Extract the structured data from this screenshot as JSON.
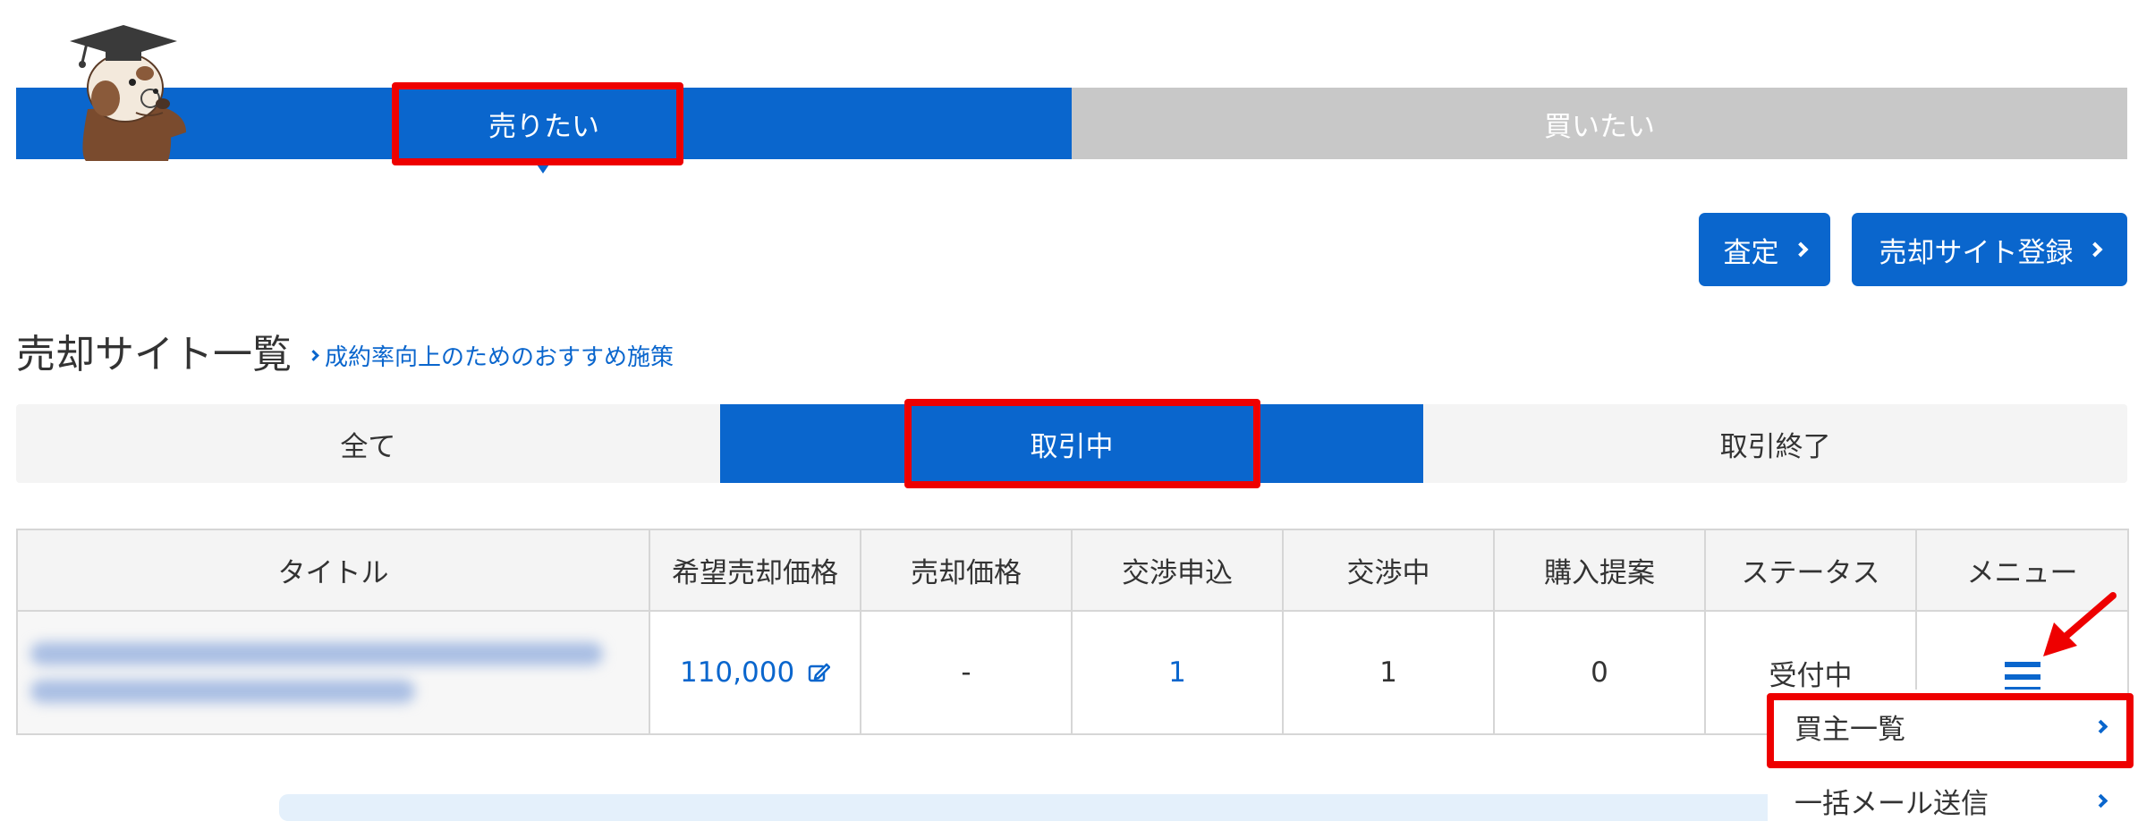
{
  "mode_tabs": [
    {
      "label": "売りたい",
      "active": true
    },
    {
      "label": "買いたい",
      "active": false
    }
  ],
  "actions": {
    "appraisal_label": "査定",
    "register_label": "売却サイト登録"
  },
  "page": {
    "title": "売却サイト一覧",
    "tip_link": "成約率向上のためのおすすめ施策"
  },
  "filter_tabs": [
    {
      "label": "全て",
      "active": false
    },
    {
      "label": "取引中",
      "active": true
    },
    {
      "label": "取引終了",
      "active": false
    }
  ],
  "table": {
    "headers": [
      "タイトル",
      "希望売却価格",
      "売却価格",
      "交渉申込",
      "交渉中",
      "購入提案",
      "ステータス",
      "メニュー"
    ],
    "rows": [
      {
        "desired_price": "110,000",
        "sale_price": "-",
        "negotiation_requests": "1",
        "negotiating": "1",
        "purchase_proposals": "0",
        "status": "受付中"
      }
    ]
  },
  "menu_dropdown": {
    "items": [
      "買主一覧",
      "一括メール送信"
    ]
  },
  "colors": {
    "primary": "#0a66cd",
    "inactive_tab": "#c8c8c8",
    "highlight": "#ee0000"
  },
  "icons": [
    "mascot-otter",
    "chevron-right-icon",
    "edit-icon",
    "hamburger-menu-icon",
    "red-arrow-icon"
  ]
}
